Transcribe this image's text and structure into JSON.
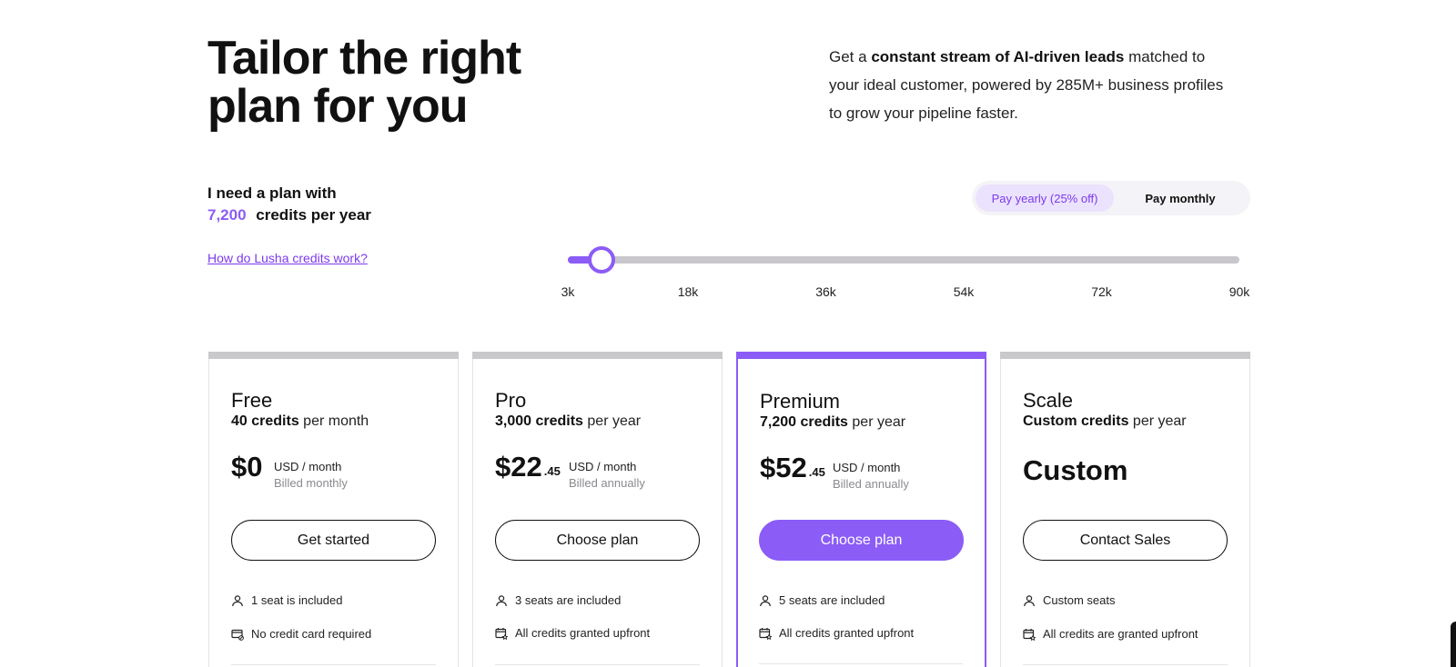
{
  "hero": {
    "title_line1": "Tailor the right",
    "title_line2": "plan for you",
    "desc_pre": "Get a ",
    "desc_bold": "constant stream of AI-driven leads",
    "desc_post": " matched to your ideal customer, powered by 285M+ business profiles to grow your pipeline faster."
  },
  "plan_selector": {
    "label_line1": "I need a plan with",
    "credits_value": "7,200",
    "credits_suffix": "credits per year",
    "help_link": "How do Lusha credits work?"
  },
  "billing_toggle": {
    "yearly_label": "Pay yearly (25% off)",
    "monthly_label": "Pay monthly",
    "selected": "yearly"
  },
  "slider": {
    "value": 7200,
    "min": 3000,
    "max": 90000,
    "ticks": [
      "3k",
      "18k",
      "36k",
      "54k",
      "72k",
      "90k"
    ]
  },
  "plans": [
    {
      "name": "Free",
      "credits_bold": "40 credits",
      "credits_period": " per month",
      "price": "$0",
      "price_cents": "",
      "price_unit": "USD / month",
      "billing": "Billed monthly",
      "cta": "Get started",
      "features": [
        "1 seat is included",
        "No credit card required"
      ]
    },
    {
      "name": "Pro",
      "credits_bold": "3,000 credits",
      "credits_period": " per year",
      "price": "$22",
      "price_cents": ".45",
      "price_unit": "USD / month",
      "billing": "Billed annually",
      "cta": "Choose plan",
      "features": [
        "3 seats are included",
        "All credits granted upfront"
      ]
    },
    {
      "name": "Premium",
      "credits_bold": "7,200 credits",
      "credits_period": " per year",
      "price": "$52",
      "price_cents": ".45",
      "price_unit": "USD / month",
      "billing": "Billed annually",
      "cta": "Choose plan",
      "features": [
        "5 seats are included",
        "All credits granted upfront"
      ],
      "highlighted": true
    },
    {
      "name": "Scale",
      "credits_bold": "Custom credits",
      "credits_period": " per year",
      "price": "Custom",
      "cta": "Contact Sales",
      "features": [
        "Custom seats",
        "All credits are granted upfront"
      ]
    }
  ],
  "colors": {
    "accent": "#8b5cf6",
    "accent_light": "#ebe3fd",
    "card_bar": "#c9c9cc",
    "text": "#111111",
    "muted": "#8a8a8f"
  },
  "icons": {
    "seat": "person-icon",
    "card": "credit-card-icon",
    "calendar": "calendar-star-icon"
  }
}
